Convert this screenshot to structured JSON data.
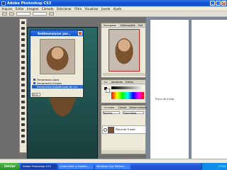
{
  "window": {
    "title": "Adobe Photoshop CS3"
  },
  "menu": [
    "Arquivo",
    "Editar",
    "Imagem",
    "Camada",
    "Selecionar",
    "Filtro",
    "Visualizar",
    "Janela",
    "Ajuda"
  ],
  "dialog": {
    "title": "Redimensionar par...",
    "items": [
      "Ferramenta Lápis",
      "Ferramenta Caneta",
      "Ferramenta Substituição de Cor"
    ],
    "zoom": "50%"
  },
  "navigator": {
    "tabs": [
      "Navegador",
      "Informações",
      "Hist"
    ]
  },
  "color": {
    "tabs": [
      "Cor",
      "Amostras",
      "Estilos"
    ]
  },
  "layers": {
    "tabs": [
      "Camadas",
      "Canais",
      "Demarcadores"
    ],
    "mode": "Normal",
    "opacity": "Opacidade",
    "layer_name": "Plano de Fundo"
  },
  "document": {
    "gloss": "Plano de fundo"
  },
  "taskbar": {
    "start": "Iniciar",
    "tasks": [
      "Adobe Photoshop CS3",
      "Como fazer o modelo...",
      "Windows Live Messen..."
    ],
    "clock": "17:03"
  }
}
